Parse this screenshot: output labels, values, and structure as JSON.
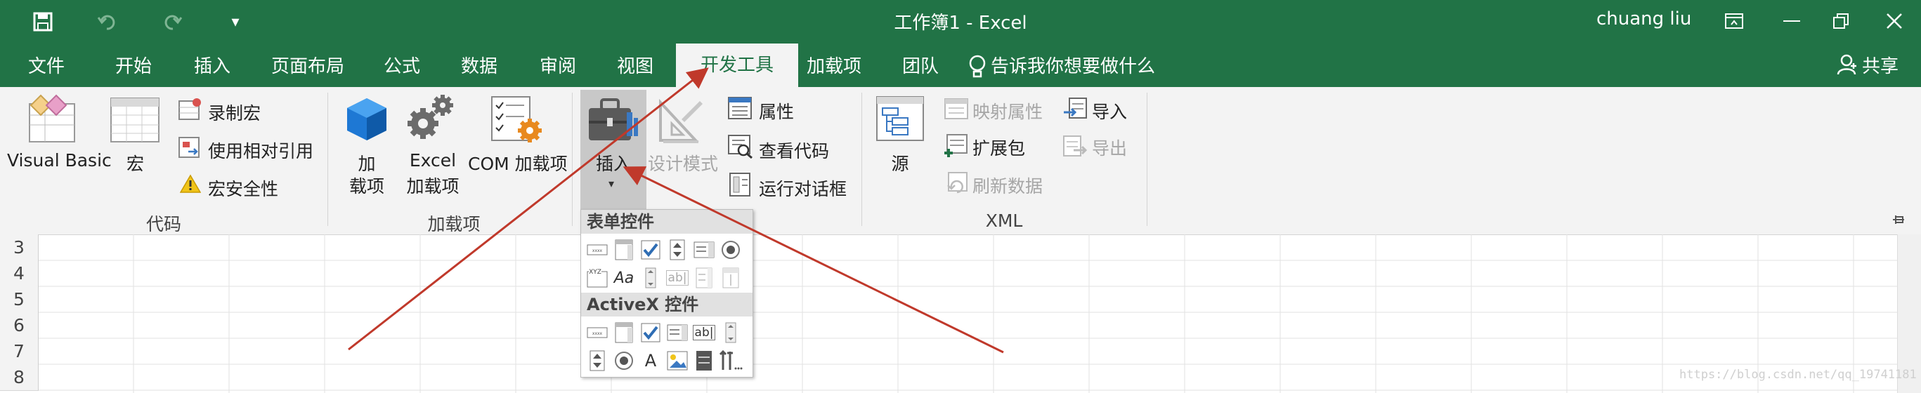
{
  "window": {
    "title": "工作簿1  -  Excel",
    "user": "chuang liu",
    "qat_dropdown": "▾"
  },
  "tabs": {
    "file": "文件",
    "home": "开始",
    "insert": "插入",
    "page_layout": "页面布局",
    "formulas": "公式",
    "data": "数据",
    "review": "审阅",
    "view": "视图",
    "developer": "开发工具",
    "addins": "加载项",
    "team": "团队",
    "tell_me": "告诉我你想要做什么",
    "share": "共享"
  },
  "ribbon": {
    "code": {
      "group_label": "代码",
      "visual_basic": "Visual Basic",
      "macros": "宏",
      "record_macro": "录制宏",
      "use_relative": "使用相对引用",
      "macro_security": "宏安全性"
    },
    "addins": {
      "group_label": "加载项",
      "addins_line1": "加",
      "addins_line2": "载项",
      "excel_addins_line1": "Excel",
      "excel_addins_line2": "加载项",
      "com_addins": "COM 加载项"
    },
    "controls": {
      "insert": "插入",
      "design_mode": "设计模式",
      "properties": "属性",
      "view_code": "查看代码",
      "run_dialog": "运行对话框"
    },
    "xml": {
      "group_label": "XML",
      "source": "源",
      "map_properties": "映射属性",
      "expansion_packs": "扩展包",
      "refresh_data": "刷新数据",
      "import": "导入",
      "export": "导出"
    }
  },
  "dropdown": {
    "form_controls": "表单控件",
    "activex_controls": "ActiveX 控件",
    "label_glyph": "Aa",
    "xyz_glyph": "XYZ",
    "ab_glyph": "ab|",
    "a_glyph": "A"
  },
  "rows": [
    "3",
    "4",
    "5",
    "6",
    "7",
    "8"
  ],
  "watermark": "https://blog.csdn.net/qq_19741181",
  "colors": {
    "excel_green": "#217346",
    "arrow_red": "#c0392b"
  }
}
